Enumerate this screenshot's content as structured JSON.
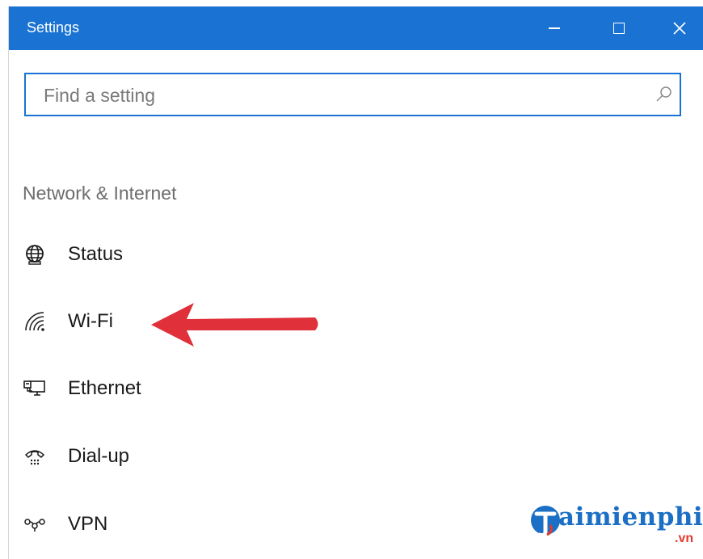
{
  "window": {
    "title": "Settings",
    "accent_color": "#1a73d2"
  },
  "search": {
    "placeholder": "Find a setting",
    "value": ""
  },
  "section": {
    "title": "Network & Internet"
  },
  "nav": {
    "items": [
      {
        "label": "Status",
        "icon": "globe-icon"
      },
      {
        "label": "Wi-Fi",
        "icon": "wifi-icon"
      },
      {
        "label": "Ethernet",
        "icon": "ethernet-icon"
      },
      {
        "label": "Dial-up",
        "icon": "dialup-icon"
      },
      {
        "label": "VPN",
        "icon": "vpn-icon"
      }
    ]
  },
  "annotation": {
    "arrow_color": "#e0303a"
  },
  "watermark": {
    "text": "aimienphi",
    "suffix": ".vn"
  }
}
